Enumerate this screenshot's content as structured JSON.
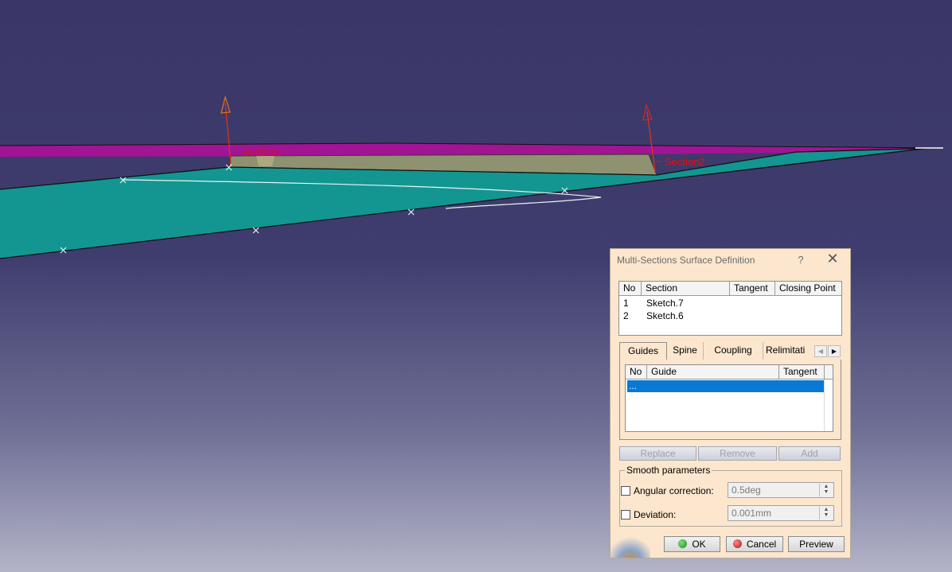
{
  "viewport": {
    "section_labels": [
      "Section1",
      "Section2"
    ]
  },
  "dialog": {
    "title": "Multi-Sections Surface Definition",
    "help": "?",
    "close": "✕",
    "sections_table": {
      "headers": [
        "No",
        "Section",
        "Tangent",
        "Closing Point"
      ],
      "rows": [
        {
          "no": "1",
          "section": "Sketch.7"
        },
        {
          "no": "2",
          "section": "Sketch.6"
        }
      ]
    },
    "tabs": [
      "Guides",
      "Spine",
      "Coupling",
      "Relimitati"
    ],
    "active_tab": "Guides",
    "guides_table": {
      "headers": [
        "No",
        "Guide",
        "Tangent"
      ],
      "rows": [
        {
          "no": "...",
          "guide": ""
        }
      ]
    },
    "list_buttons": [
      "Replace",
      "Remove",
      "Add"
    ],
    "smooth": {
      "title": "Smooth parameters",
      "angular_label": "Angular correction:",
      "angular_value": "0.5deg",
      "deviation_label": "Deviation:",
      "deviation_value": "0.001mm"
    },
    "footer": {
      "ok": "OK",
      "cancel": "Cancel",
      "preview": "Preview"
    },
    "colors": {
      "background": "#fce6cd",
      "selection": "#0a79d4"
    }
  }
}
